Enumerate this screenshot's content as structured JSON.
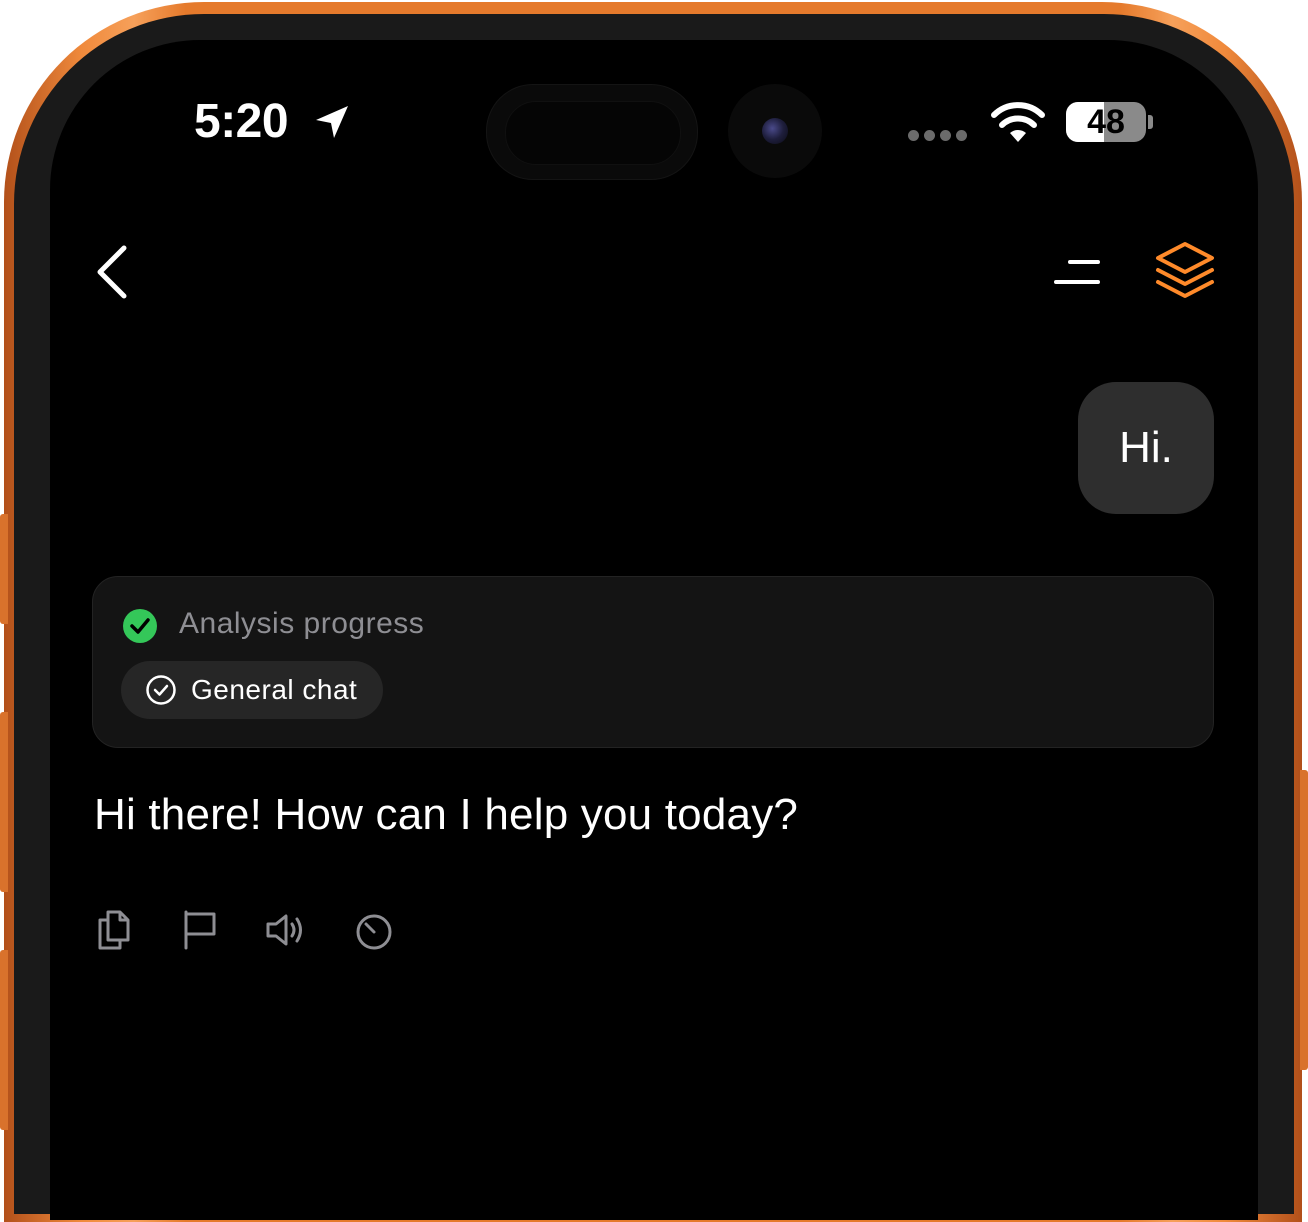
{
  "status_bar": {
    "time": "5:20",
    "battery_level": "48",
    "battery_fraction": 0.48
  },
  "nav": {
    "back_icon": "chevron-left-icon",
    "menu_icon": "menu-icon",
    "layers_icon": "layers-icon",
    "accent_color": "#ff8a2a"
  },
  "conversation": {
    "user_message": "Hi.",
    "analysis": {
      "title": "Analysis progress",
      "status_color": "#34c759",
      "chip_label": "General chat"
    },
    "assistant_message": "Hi there! How can I help you today?",
    "actions": [
      {
        "icon": "copy-icon"
      },
      {
        "icon": "flag-icon"
      },
      {
        "icon": "speaker-icon"
      },
      {
        "icon": "timer-icon"
      }
    ]
  },
  "device": {
    "frame_color": "#e57a2c"
  }
}
